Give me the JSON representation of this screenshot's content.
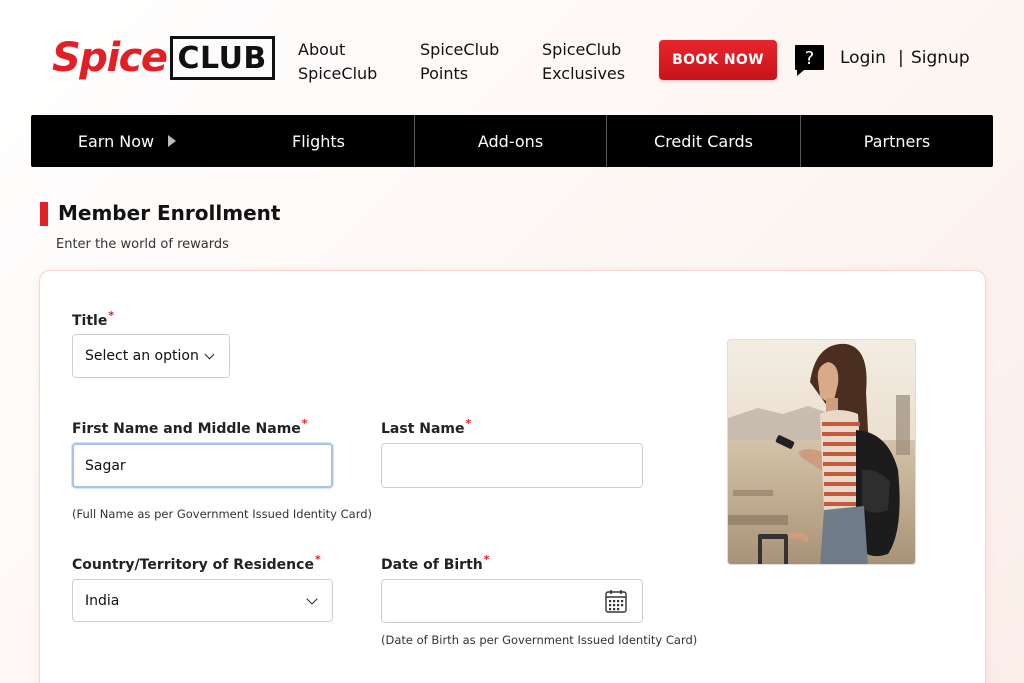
{
  "header": {
    "logo": {
      "spice": "Spice",
      "club": "CLUB"
    },
    "links": [
      {
        "line1": "About",
        "line2": "SpiceClub"
      },
      {
        "line1": "SpiceClub",
        "line2": "Points"
      },
      {
        "line1": "SpiceClub",
        "line2": "Exclusives"
      }
    ],
    "book_now": "BOOK NOW",
    "help_glyph": "?",
    "login": "Login",
    "separator": "|",
    "signup": "Signup"
  },
  "nav": {
    "items": [
      {
        "label": "Earn Now"
      },
      {
        "label": "Flights"
      },
      {
        "label": "Add-ons"
      },
      {
        "label": "Credit Cards"
      },
      {
        "label": "Partners"
      }
    ]
  },
  "section": {
    "title": "Member Enrollment",
    "subtitle": "Enter the world of rewards"
  },
  "form": {
    "title_label": "Title",
    "title_value": "Select an option",
    "first_name_label": "First Name and Middle Name",
    "first_name_value": "Sagar",
    "last_name_label": "Last Name",
    "last_name_value": "",
    "name_hint": "(Full Name as per Government Issued Identity Card)",
    "country_label": "Country/Territory of Residence",
    "country_value": "India",
    "dob_label": "Date of Birth",
    "dob_value": "",
    "dob_hint": "(Date of Birth as per Government Issued Identity Card)",
    "required_mark": "*"
  },
  "colors": {
    "brand_red": "#e31e24",
    "nav_bg": "#000000",
    "focus_border": "#a8c2ec"
  },
  "icons": {
    "help": "help-question-icon",
    "calendar": "calendar-icon",
    "dropdown": "chevron-down-icon",
    "nav_arrow": "caret-right-icon"
  }
}
